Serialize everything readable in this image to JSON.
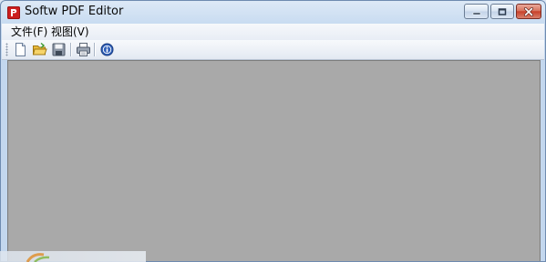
{
  "window": {
    "title": "Softw PDF Editor",
    "icon": "pdf-app-icon",
    "controls": [
      "minimize-icon",
      "maximize-icon",
      "close-icon"
    ]
  },
  "menubar": {
    "items": [
      {
        "label": "文件(F)"
      },
      {
        "label": "视图(V)"
      }
    ]
  },
  "toolbar": {
    "buttons": [
      {
        "icon": "new-document-icon"
      },
      {
        "icon": "open-folder-icon"
      },
      {
        "icon": "save-icon"
      },
      {
        "icon": "print-icon"
      },
      {
        "icon": "info-icon"
      }
    ]
  },
  "colors": {
    "workspace": "#a9a9a9",
    "app_icon": "#cc1f1f",
    "close_button": "#c8412a"
  }
}
